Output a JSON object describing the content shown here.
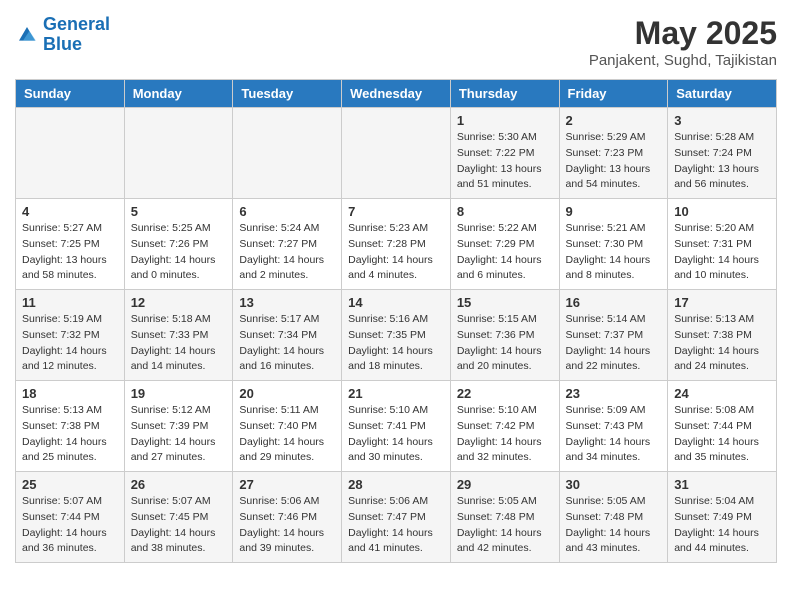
{
  "header": {
    "logo_line1": "General",
    "logo_line2": "Blue",
    "month_title": "May 2025",
    "location": "Panjakent, Sughd, Tajikistan"
  },
  "weekdays": [
    "Sunday",
    "Monday",
    "Tuesday",
    "Wednesday",
    "Thursday",
    "Friday",
    "Saturday"
  ],
  "weeks": [
    [
      {
        "day": "",
        "sunrise": "",
        "sunset": "",
        "daylight": ""
      },
      {
        "day": "",
        "sunrise": "",
        "sunset": "",
        "daylight": ""
      },
      {
        "day": "",
        "sunrise": "",
        "sunset": "",
        "daylight": ""
      },
      {
        "day": "",
        "sunrise": "",
        "sunset": "",
        "daylight": ""
      },
      {
        "day": "1",
        "sunrise": "Sunrise: 5:30 AM",
        "sunset": "Sunset: 7:22 PM",
        "daylight": "Daylight: 13 hours and 51 minutes."
      },
      {
        "day": "2",
        "sunrise": "Sunrise: 5:29 AM",
        "sunset": "Sunset: 7:23 PM",
        "daylight": "Daylight: 13 hours and 54 minutes."
      },
      {
        "day": "3",
        "sunrise": "Sunrise: 5:28 AM",
        "sunset": "Sunset: 7:24 PM",
        "daylight": "Daylight: 13 hours and 56 minutes."
      }
    ],
    [
      {
        "day": "4",
        "sunrise": "Sunrise: 5:27 AM",
        "sunset": "Sunset: 7:25 PM",
        "daylight": "Daylight: 13 hours and 58 minutes."
      },
      {
        "day": "5",
        "sunrise": "Sunrise: 5:25 AM",
        "sunset": "Sunset: 7:26 PM",
        "daylight": "Daylight: 14 hours and 0 minutes."
      },
      {
        "day": "6",
        "sunrise": "Sunrise: 5:24 AM",
        "sunset": "Sunset: 7:27 PM",
        "daylight": "Daylight: 14 hours and 2 minutes."
      },
      {
        "day": "7",
        "sunrise": "Sunrise: 5:23 AM",
        "sunset": "Sunset: 7:28 PM",
        "daylight": "Daylight: 14 hours and 4 minutes."
      },
      {
        "day": "8",
        "sunrise": "Sunrise: 5:22 AM",
        "sunset": "Sunset: 7:29 PM",
        "daylight": "Daylight: 14 hours and 6 minutes."
      },
      {
        "day": "9",
        "sunrise": "Sunrise: 5:21 AM",
        "sunset": "Sunset: 7:30 PM",
        "daylight": "Daylight: 14 hours and 8 minutes."
      },
      {
        "day": "10",
        "sunrise": "Sunrise: 5:20 AM",
        "sunset": "Sunset: 7:31 PM",
        "daylight": "Daylight: 14 hours and 10 minutes."
      }
    ],
    [
      {
        "day": "11",
        "sunrise": "Sunrise: 5:19 AM",
        "sunset": "Sunset: 7:32 PM",
        "daylight": "Daylight: 14 hours and 12 minutes."
      },
      {
        "day": "12",
        "sunrise": "Sunrise: 5:18 AM",
        "sunset": "Sunset: 7:33 PM",
        "daylight": "Daylight: 14 hours and 14 minutes."
      },
      {
        "day": "13",
        "sunrise": "Sunrise: 5:17 AM",
        "sunset": "Sunset: 7:34 PM",
        "daylight": "Daylight: 14 hours and 16 minutes."
      },
      {
        "day": "14",
        "sunrise": "Sunrise: 5:16 AM",
        "sunset": "Sunset: 7:35 PM",
        "daylight": "Daylight: 14 hours and 18 minutes."
      },
      {
        "day": "15",
        "sunrise": "Sunrise: 5:15 AM",
        "sunset": "Sunset: 7:36 PM",
        "daylight": "Daylight: 14 hours and 20 minutes."
      },
      {
        "day": "16",
        "sunrise": "Sunrise: 5:14 AM",
        "sunset": "Sunset: 7:37 PM",
        "daylight": "Daylight: 14 hours and 22 minutes."
      },
      {
        "day": "17",
        "sunrise": "Sunrise: 5:13 AM",
        "sunset": "Sunset: 7:38 PM",
        "daylight": "Daylight: 14 hours and 24 minutes."
      }
    ],
    [
      {
        "day": "18",
        "sunrise": "Sunrise: 5:13 AM",
        "sunset": "Sunset: 7:38 PM",
        "daylight": "Daylight: 14 hours and 25 minutes."
      },
      {
        "day": "19",
        "sunrise": "Sunrise: 5:12 AM",
        "sunset": "Sunset: 7:39 PM",
        "daylight": "Daylight: 14 hours and 27 minutes."
      },
      {
        "day": "20",
        "sunrise": "Sunrise: 5:11 AM",
        "sunset": "Sunset: 7:40 PM",
        "daylight": "Daylight: 14 hours and 29 minutes."
      },
      {
        "day": "21",
        "sunrise": "Sunrise: 5:10 AM",
        "sunset": "Sunset: 7:41 PM",
        "daylight": "Daylight: 14 hours and 30 minutes."
      },
      {
        "day": "22",
        "sunrise": "Sunrise: 5:10 AM",
        "sunset": "Sunset: 7:42 PM",
        "daylight": "Daylight: 14 hours and 32 minutes."
      },
      {
        "day": "23",
        "sunrise": "Sunrise: 5:09 AM",
        "sunset": "Sunset: 7:43 PM",
        "daylight": "Daylight: 14 hours and 34 minutes."
      },
      {
        "day": "24",
        "sunrise": "Sunrise: 5:08 AM",
        "sunset": "Sunset: 7:44 PM",
        "daylight": "Daylight: 14 hours and 35 minutes."
      }
    ],
    [
      {
        "day": "25",
        "sunrise": "Sunrise: 5:07 AM",
        "sunset": "Sunset: 7:44 PM",
        "daylight": "Daylight: 14 hours and 36 minutes."
      },
      {
        "day": "26",
        "sunrise": "Sunrise: 5:07 AM",
        "sunset": "Sunset: 7:45 PM",
        "daylight": "Daylight: 14 hours and 38 minutes."
      },
      {
        "day": "27",
        "sunrise": "Sunrise: 5:06 AM",
        "sunset": "Sunset: 7:46 PM",
        "daylight": "Daylight: 14 hours and 39 minutes."
      },
      {
        "day": "28",
        "sunrise": "Sunrise: 5:06 AM",
        "sunset": "Sunset: 7:47 PM",
        "daylight": "Daylight: 14 hours and 41 minutes."
      },
      {
        "day": "29",
        "sunrise": "Sunrise: 5:05 AM",
        "sunset": "Sunset: 7:48 PM",
        "daylight": "Daylight: 14 hours and 42 minutes."
      },
      {
        "day": "30",
        "sunrise": "Sunrise: 5:05 AM",
        "sunset": "Sunset: 7:48 PM",
        "daylight": "Daylight: 14 hours and 43 minutes."
      },
      {
        "day": "31",
        "sunrise": "Sunrise: 5:04 AM",
        "sunset": "Sunset: 7:49 PM",
        "daylight": "Daylight: 14 hours and 44 minutes."
      }
    ]
  ]
}
